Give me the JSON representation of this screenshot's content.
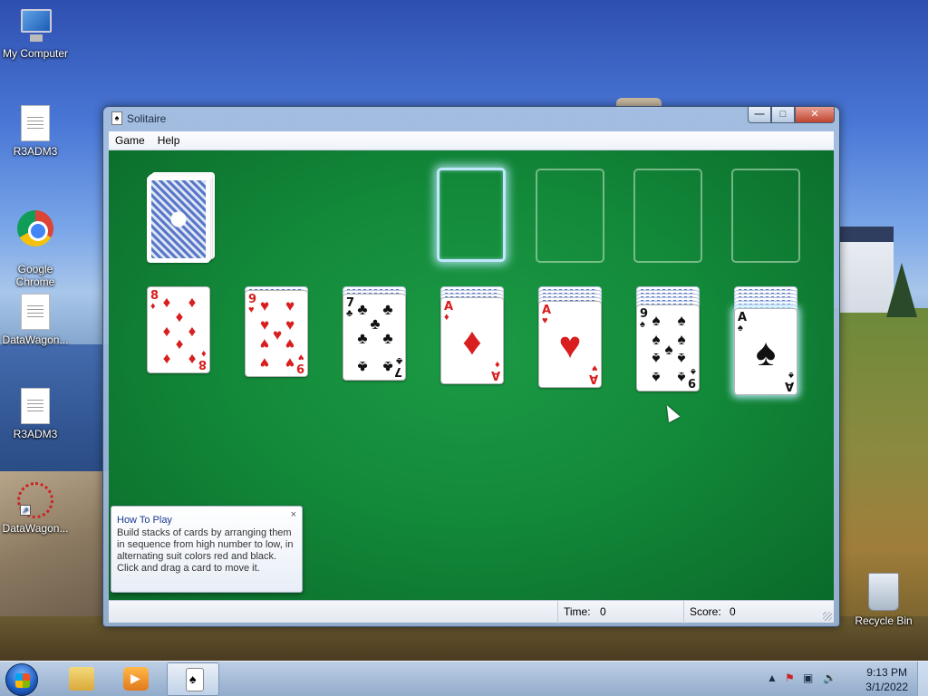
{
  "desktop": {
    "icons": [
      {
        "label": "My Computer",
        "icon": "computer-icon"
      },
      {
        "label": "R3ADM3",
        "icon": "document-icon"
      },
      {
        "label": "Google\nChrome",
        "icon": "chrome-icon"
      },
      {
        "label": "DataWagon...",
        "icon": "document-icon"
      },
      {
        "label": "R3ADM3",
        "icon": "document-icon"
      },
      {
        "label": "DataWagon...",
        "icon": "ferris-wheel-icon"
      }
    ],
    "recycle_bin": {
      "label": "Recycle Bin",
      "icon": "recycle-bin-icon"
    }
  },
  "window": {
    "title": "Solitaire",
    "menu": [
      "Game",
      "Help"
    ],
    "caption_buttons": {
      "minimize": "—",
      "maximize": "□",
      "close": "✕"
    }
  },
  "game": {
    "stock": {
      "face_down": true
    },
    "foundations": [
      {
        "empty": true,
        "highlighted": true
      },
      {
        "empty": true,
        "highlighted": false
      },
      {
        "empty": true,
        "highlighted": false
      },
      {
        "empty": true,
        "highlighted": false
      }
    ],
    "tableau": [
      {
        "hidden_count": 0,
        "top": {
          "rank": "8",
          "suit": "♦",
          "color": "red"
        }
      },
      {
        "hidden_count": 1,
        "top": {
          "rank": "9",
          "suit": "♥",
          "color": "red"
        }
      },
      {
        "hidden_count": 2,
        "top": {
          "rank": "7",
          "suit": "♣",
          "color": "black"
        }
      },
      {
        "hidden_count": 3,
        "top": {
          "rank": "A",
          "suit": "♦",
          "color": "red"
        }
      },
      {
        "hidden_count": 4,
        "top": {
          "rank": "A",
          "suit": "♥",
          "color": "red"
        }
      },
      {
        "hidden_count": 5,
        "top": {
          "rank": "9",
          "suit": "♠",
          "color": "black"
        }
      },
      {
        "hidden_count": 6,
        "top": {
          "rank": "A",
          "suit": "♠",
          "color": "black"
        },
        "selected": true
      }
    ]
  },
  "tip": {
    "title": "How To Play",
    "body": "Build stacks of cards by arranging them in sequence from high number to low, in alternating suit colors red and black. Click and drag a card to move it.",
    "close": "×"
  },
  "status": {
    "time_label": "Time:",
    "time_value": "0",
    "score_label": "Score:",
    "score_value": "0"
  },
  "taskbar": {
    "pinned": [
      {
        "name": "windows-explorer",
        "icon": "folder-icon"
      },
      {
        "name": "windows-media-player",
        "icon": "media-player-icon"
      },
      {
        "name": "solitaire",
        "icon": "solitaire-icon",
        "active": true
      }
    ],
    "tray_icons": [
      "show-hidden-icons",
      "action-center-icon",
      "network-icon",
      "volume-icon"
    ],
    "clock": {
      "time": "9:13 PM",
      "date": "3/1/2022"
    }
  },
  "colors": {
    "felt": "#138a3a",
    "red_suit": "#d81e1e",
    "black_suit": "#111111",
    "foundation_glow": "#bfe8ff"
  }
}
